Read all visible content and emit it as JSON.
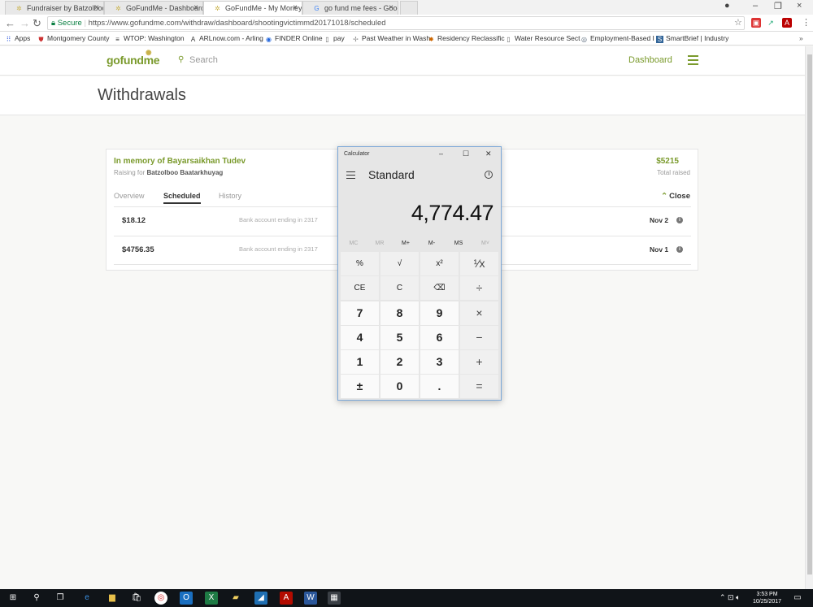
{
  "browser": {
    "tabs": [
      {
        "title": "Fundraiser by Batzolboo",
        "active": false
      },
      {
        "title": "GoFundMe - Dashboard",
        "active": false
      },
      {
        "title": "GoFundMe - My Money",
        "active": true
      },
      {
        "title": "go fund me fees - Googl",
        "active": false
      }
    ],
    "secure_label": "Secure",
    "url": "https://www.gofundme.com/withdraw/dashboard/shootingvictimmd20171018/scheduled",
    "bookmarks": [
      "Apps",
      "Montgomery County",
      "WTOP: Washington",
      "ARLnow.com - Arling",
      "FINDER Online",
      "pay",
      "Past Weather in Wash",
      "Residency Reclassific",
      "Water Resource Sect",
      "Employment-Based I",
      "SmartBrief | Industry"
    ]
  },
  "site": {
    "logo": "gofundme",
    "search_placeholder": "Search",
    "dashboard_label": "Dashboard",
    "page_title": "Withdrawals"
  },
  "campaign": {
    "name": "In memory of Bayarsaikhan Tudev",
    "raising_for_label": "Raising for",
    "beneficiary": "Batzolboo Baatarkhuyag",
    "total": "$5215",
    "total_label": "Total raised",
    "tabs": [
      "Overview",
      "Scheduled",
      "History"
    ],
    "selected_tab": "Scheduled",
    "close_label": "Close",
    "withdrawals": [
      {
        "amount": "$18.12",
        "bank": "Bank account ending in 2317",
        "date": "Nov 2"
      },
      {
        "amount": "$4756.35",
        "bank": "Bank account ending in 2317",
        "date": "Nov 1"
      }
    ]
  },
  "calculator": {
    "title": "Calculator",
    "mode": "Standard",
    "display": "4,774.47",
    "memory": [
      "MC",
      "MR",
      "M+",
      "M-",
      "MS",
      "M˅"
    ],
    "keys": [
      [
        "%",
        "√",
        "x²",
        "¹⁄x"
      ],
      [
        "CE",
        "C",
        "⌫",
        "÷"
      ],
      [
        "7",
        "8",
        "9",
        "×"
      ],
      [
        "4",
        "5",
        "6",
        "−"
      ],
      [
        "1",
        "2",
        "3",
        "+"
      ],
      [
        "±",
        "0",
        ".",
        "="
      ]
    ]
  },
  "taskbar": {
    "time": "3:53 PM",
    "date": "10/25/2017"
  },
  "colors": {
    "brand_green": "#7a9a2c",
    "taskbar": "#101418"
  }
}
